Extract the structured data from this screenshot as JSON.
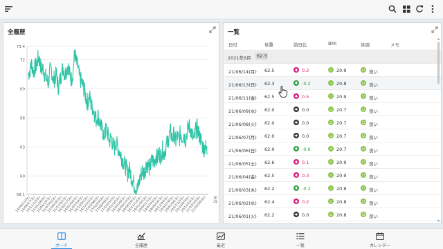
{
  "topbar": {
    "menu_icon": "hamburger-menu-icon",
    "search_icon": "search-icon",
    "grid_icon": "grid-view-icon",
    "refresh_icon": "refresh-icon",
    "more_icon": "more-vertical-icon"
  },
  "left_panel": {
    "title": "全履歴",
    "expand_icon": "expand-icon"
  },
  "chart_data": {
    "type": "line",
    "title": "",
    "xlabel": "日付",
    "ylabel": "",
    "ylim": [
      58.1,
      73.4
    ],
    "y_ticks": [
      58.1,
      60,
      63,
      66,
      69,
      72,
      73.4
    ],
    "x_tick_labels": [
      "14/06/11(水)",
      "14/08/27(水)",
      "14/11/12(水)",
      "15/01/28(水)",
      "15/04/15(水)",
      "15/07/01(水)",
      "15/09/16(水)",
      "15/12/02(水)",
      "16/02/17(水)",
      "16/05/04(水)",
      "16/07/20(水)",
      "16/10/05(水)",
      "16/12/21(水)",
      "17/03/08(水)",
      "17/05/24(水)",
      "17/08/09(水)",
      "17/10/25(水)",
      "18/01/10(水)",
      "18/03/28(水)",
      "18/06/13(水)",
      "18/08/29(水)",
      "18/11/14(水)",
      "19/01/30(水)",
      "19/04/17(水)",
      "19/07/03(水)",
      "19/09/18(水)",
      "19/12/04(水)",
      "20/02/19(水)",
      "20/05/06(水)",
      "20/07/22(水)",
      "20/10/07(水)",
      "20/12/23(水)",
      "21/03/10(水)",
      "21/05/26(水)"
    ],
    "series": [
      {
        "color": "#2ec4a5",
        "values": [
          70.5,
          71.0,
          71.6,
          70.8,
          71.2,
          71.5,
          72.3,
          71.8,
          70.9,
          71.2,
          70.4,
          70.0,
          69.6,
          70.8,
          71.0,
          69.8,
          70.2,
          70.5,
          69.2,
          69.8,
          70.6,
          71.3,
          70.4,
          71.0,
          71.4,
          70.5,
          70.0,
          70.8,
          72.8,
          71.7,
          71.2,
          70.1,
          69.8,
          69.3,
          68.8,
          67.9,
          67.6,
          68.2,
          67.3,
          67.0,
          66.5,
          65.8,
          66.3,
          65.7,
          65.0,
          64.6,
          64.1,
          64.9,
          64.3,
          63.6,
          64.0,
          63.3,
          62.8,
          63.5,
          63.0,
          62.6,
          62.1,
          61.7,
          61.3,
          60.9,
          60.3,
          60.8,
          60.1,
          59.6,
          59.1,
          58.8,
          58.6,
          59.4,
          60.1,
          60.6,
          60.3,
          61.0,
          61.4,
          60.8,
          61.2,
          61.7,
          61.3,
          62.1,
          61.8,
          62.4,
          62.0,
          62.8,
          62.3,
          62.9,
          63.4,
          64.1,
          64.6,
          63.8,
          64.3,
          63.5,
          64.2,
          63.6,
          64.5,
          63.9,
          64.4,
          63.7,
          64.6,
          65.2,
          64.9,
          64.3,
          63.6,
          64.6,
          65.0,
          64.4,
          63.9,
          63.3,
          62.8,
          63.1,
          62.5
        ]
      }
    ]
  },
  "right_panel": {
    "title": "一覧",
    "expand_icon": "expand-icon",
    "columns": [
      "日付",
      "体重",
      "前日比",
      "BMI",
      "体調",
      "メモ"
    ],
    "group": {
      "label": "2021年6月",
      "value": "62.3"
    },
    "rows": [
      {
        "date": "21/06/14(月)",
        "weight": "62.5",
        "diff": "0.2",
        "trend": "up",
        "bmi": "20.9",
        "cond": "良い"
      },
      {
        "date": "21/06/13(日)",
        "weight": "62.3",
        "diff": "-0.2",
        "trend": "down",
        "bmi": "20.8",
        "cond": "良い"
      },
      {
        "date": "21/06/11(金)",
        "weight": "62.5",
        "diff": "0.5",
        "trend": "up",
        "bmi": "20.9",
        "cond": "良い"
      },
      {
        "date": "21/06/09(水)",
        "weight": "62.0",
        "diff": "0.0",
        "trend": "flat",
        "bmi": "20.7",
        "cond": "良い"
      },
      {
        "date": "21/06/08(火)",
        "weight": "62.0",
        "diff": "0.0",
        "trend": "flat",
        "bmi": "20.7",
        "cond": "良い"
      },
      {
        "date": "21/06/07(月)",
        "weight": "62.0",
        "diff": "0.0",
        "trend": "flat",
        "bmi": "20.7",
        "cond": "良い"
      },
      {
        "date": "21/06/06(日)",
        "weight": "62.0",
        "diff": "-0.6",
        "trend": "down",
        "bmi": "20.7",
        "cond": "良い"
      },
      {
        "date": "21/06/05(土)",
        "weight": "62.6",
        "diff": "0.1",
        "trend": "up",
        "bmi": "20.9",
        "cond": "良い"
      },
      {
        "date": "21/06/04(金)",
        "weight": "62.5",
        "diff": "0.3",
        "trend": "up",
        "bmi": "20.9",
        "cond": "良い"
      },
      {
        "date": "21/06/03(木)",
        "weight": "62.2",
        "diff": "-0.2",
        "trend": "down",
        "bmi": "20.8",
        "cond": "良い"
      },
      {
        "date": "21/06/02(水)",
        "weight": "62.4",
        "diff": "0.2",
        "trend": "up",
        "bmi": "20.8",
        "cond": "良い"
      },
      {
        "date": "21/06/01(火)",
        "weight": "62.2",
        "diff": "0.0",
        "trend": "flat",
        "bmi": "20.8",
        "cond": "良い"
      }
    ]
  },
  "colors": {
    "up": "#d81b7a",
    "down": "#2e9e3e",
    "flat": "#333333",
    "accent": "#1e88e5",
    "line": "#2ec4a5",
    "smile": "#8bc34a"
  },
  "nav": [
    {
      "label": "ボード",
      "icon": "board-icon",
      "active": true
    },
    {
      "label": "全履歴",
      "icon": "chart-icon",
      "active": false
    },
    {
      "label": "最近",
      "icon": "recent-icon",
      "active": false
    },
    {
      "label": "一覧",
      "icon": "list-icon",
      "active": false
    },
    {
      "label": "カレンダー",
      "icon": "calendar-icon",
      "active": false
    }
  ]
}
